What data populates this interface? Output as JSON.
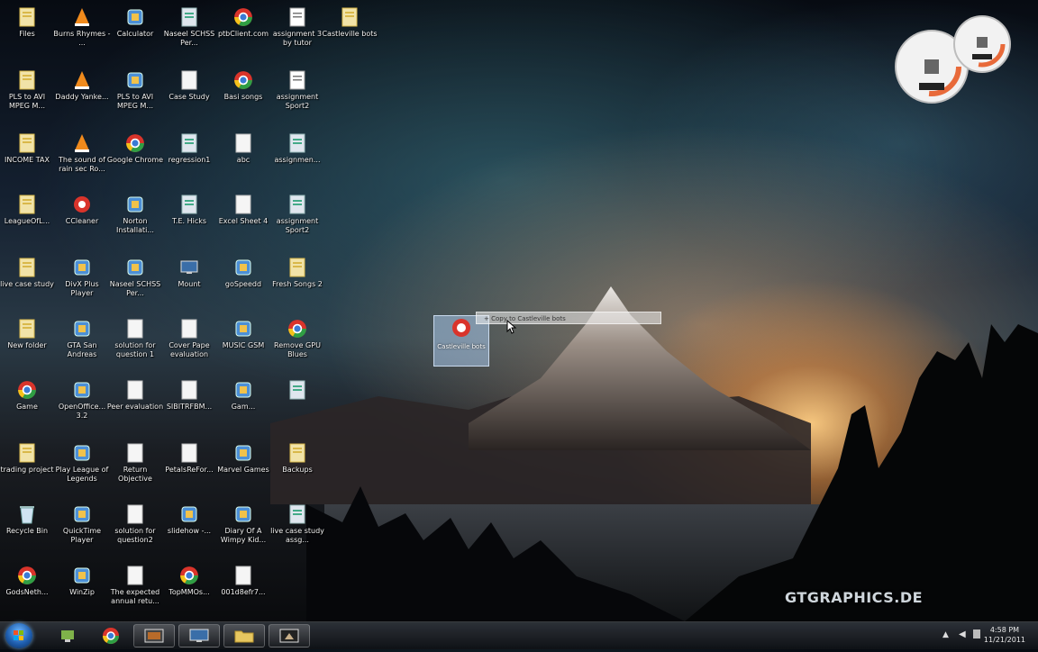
{
  "desktop": {
    "icons": [
      {
        "label": "Files",
        "kind": "folder"
      },
      {
        "label": "Burns Rhymes - ...",
        "kind": "vlc"
      },
      {
        "label": "Calculator",
        "kind": "app"
      },
      {
        "label": "Naseel SCHSS Per...",
        "kind": "doc"
      },
      {
        "label": "ptbClient.com",
        "kind": "chrome"
      },
      {
        "label": "assignment 3 by tutor",
        "kind": "text"
      },
      {
        "label": "Castleville bots",
        "kind": "folder"
      },
      {
        "label": "PLS to AVI MPEG M...",
        "kind": "folder"
      },
      {
        "label": "Daddy Yanke...",
        "kind": "vlc"
      },
      {
        "label": "PLS to AVI MPEG M...",
        "kind": "app"
      },
      {
        "label": "Case Study",
        "kind": "white"
      },
      {
        "label": "Basi songs",
        "kind": "chrome"
      },
      {
        "label": "assignment Sport2",
        "kind": "text"
      },
      {
        "label": "INCOME TAX",
        "kind": "folder"
      },
      {
        "label": "The sound of rain sec Ro...",
        "kind": "vlc"
      },
      {
        "label": "Google Chrome",
        "kind": "chrome"
      },
      {
        "label": "regression1",
        "kind": "doc"
      },
      {
        "label": "abc",
        "kind": "white"
      },
      {
        "label": "assignmen...",
        "kind": "doc"
      },
      {
        "label": "LeagueOfL...",
        "kind": "folder"
      },
      {
        "label": "CCleaner",
        "kind": "cc"
      },
      {
        "label": "Norton Installati...",
        "kind": "app"
      },
      {
        "label": "T.E. Hicks",
        "kind": "doc"
      },
      {
        "label": "Excel Sheet 4",
        "kind": "white"
      },
      {
        "label": "assignment Sport2",
        "kind": "doc"
      },
      {
        "label": "live case study",
        "kind": "folder"
      },
      {
        "label": "DivX Plus Player",
        "kind": "app"
      },
      {
        "label": "Naseel SCHSS Per...",
        "kind": "app"
      },
      {
        "label": "Mount",
        "kind": "monitor"
      },
      {
        "label": "goSpeedd",
        "kind": "app"
      },
      {
        "label": "Fresh Songs 2",
        "kind": "folder"
      },
      {
        "label": "New folder",
        "kind": "folder"
      },
      {
        "label": "GTA San Andreas",
        "kind": "app"
      },
      {
        "label": "solution for question 1",
        "kind": "white"
      },
      {
        "label": "Cover Pape evaluation",
        "kind": "white"
      },
      {
        "label": "MUSIC GSM",
        "kind": "app"
      },
      {
        "label": "Remove GPU Blues",
        "kind": "chrome"
      },
      {
        "label": "Game",
        "kind": "chrome"
      },
      {
        "label": "OpenOffice... 3.2",
        "kind": "app"
      },
      {
        "label": "Peer evaluation",
        "kind": "white"
      },
      {
        "label": "SIBITRFBM...",
        "kind": "white"
      },
      {
        "label": "Gam...",
        "kind": "app"
      },
      {
        "label": "",
        "kind": "doc"
      },
      {
        "label": "trading project",
        "kind": "folder"
      },
      {
        "label": "Play League of Legends",
        "kind": "app"
      },
      {
        "label": "Return Objective",
        "kind": "white"
      },
      {
        "label": "PetalsReFor...",
        "kind": "white"
      },
      {
        "label": "Marvel Games",
        "kind": "app"
      },
      {
        "label": "Backups",
        "kind": "folder"
      },
      {
        "label": "Recycle Bin",
        "kind": "recycle"
      },
      {
        "label": "QuickTime Player",
        "kind": "app"
      },
      {
        "label": "solution for question2",
        "kind": "white"
      },
      {
        "label": "slidehow -...",
        "kind": "app"
      },
      {
        "label": "Diary Of A Wimpy Kid...",
        "kind": "app"
      },
      {
        "label": "live case study assg...",
        "kind": "doc"
      },
      {
        "label": "GodsNeth...",
        "kind": "chrome"
      },
      {
        "label": "WinZip",
        "kind": "app"
      },
      {
        "label": "The expected annual retu...",
        "kind": "white"
      },
      {
        "label": "TopMMOs...",
        "kind": "chrome"
      },
      {
        "label": "001d8efr7...",
        "kind": "white"
      }
    ],
    "drag_icon": {
      "label": "Castleville bots",
      "tooltip": "+ Copy to Castleville bots"
    },
    "watermark": "GTGRAPHICS.DE"
  },
  "taskbar": {
    "clock_time": "4:58 PM",
    "clock_date": "11/21/2011"
  },
  "colors": {
    "folder": "#d9b84a",
    "vlc": "#f08a1c",
    "chrome_red": "#d9342b",
    "chrome_yellow": "#f4c21b",
    "chrome_green": "#2f9e44",
    "chrome_blue": "#3a7bd5",
    "doc": "#dfe6ee",
    "gadget_ring": "#e86a3a"
  }
}
